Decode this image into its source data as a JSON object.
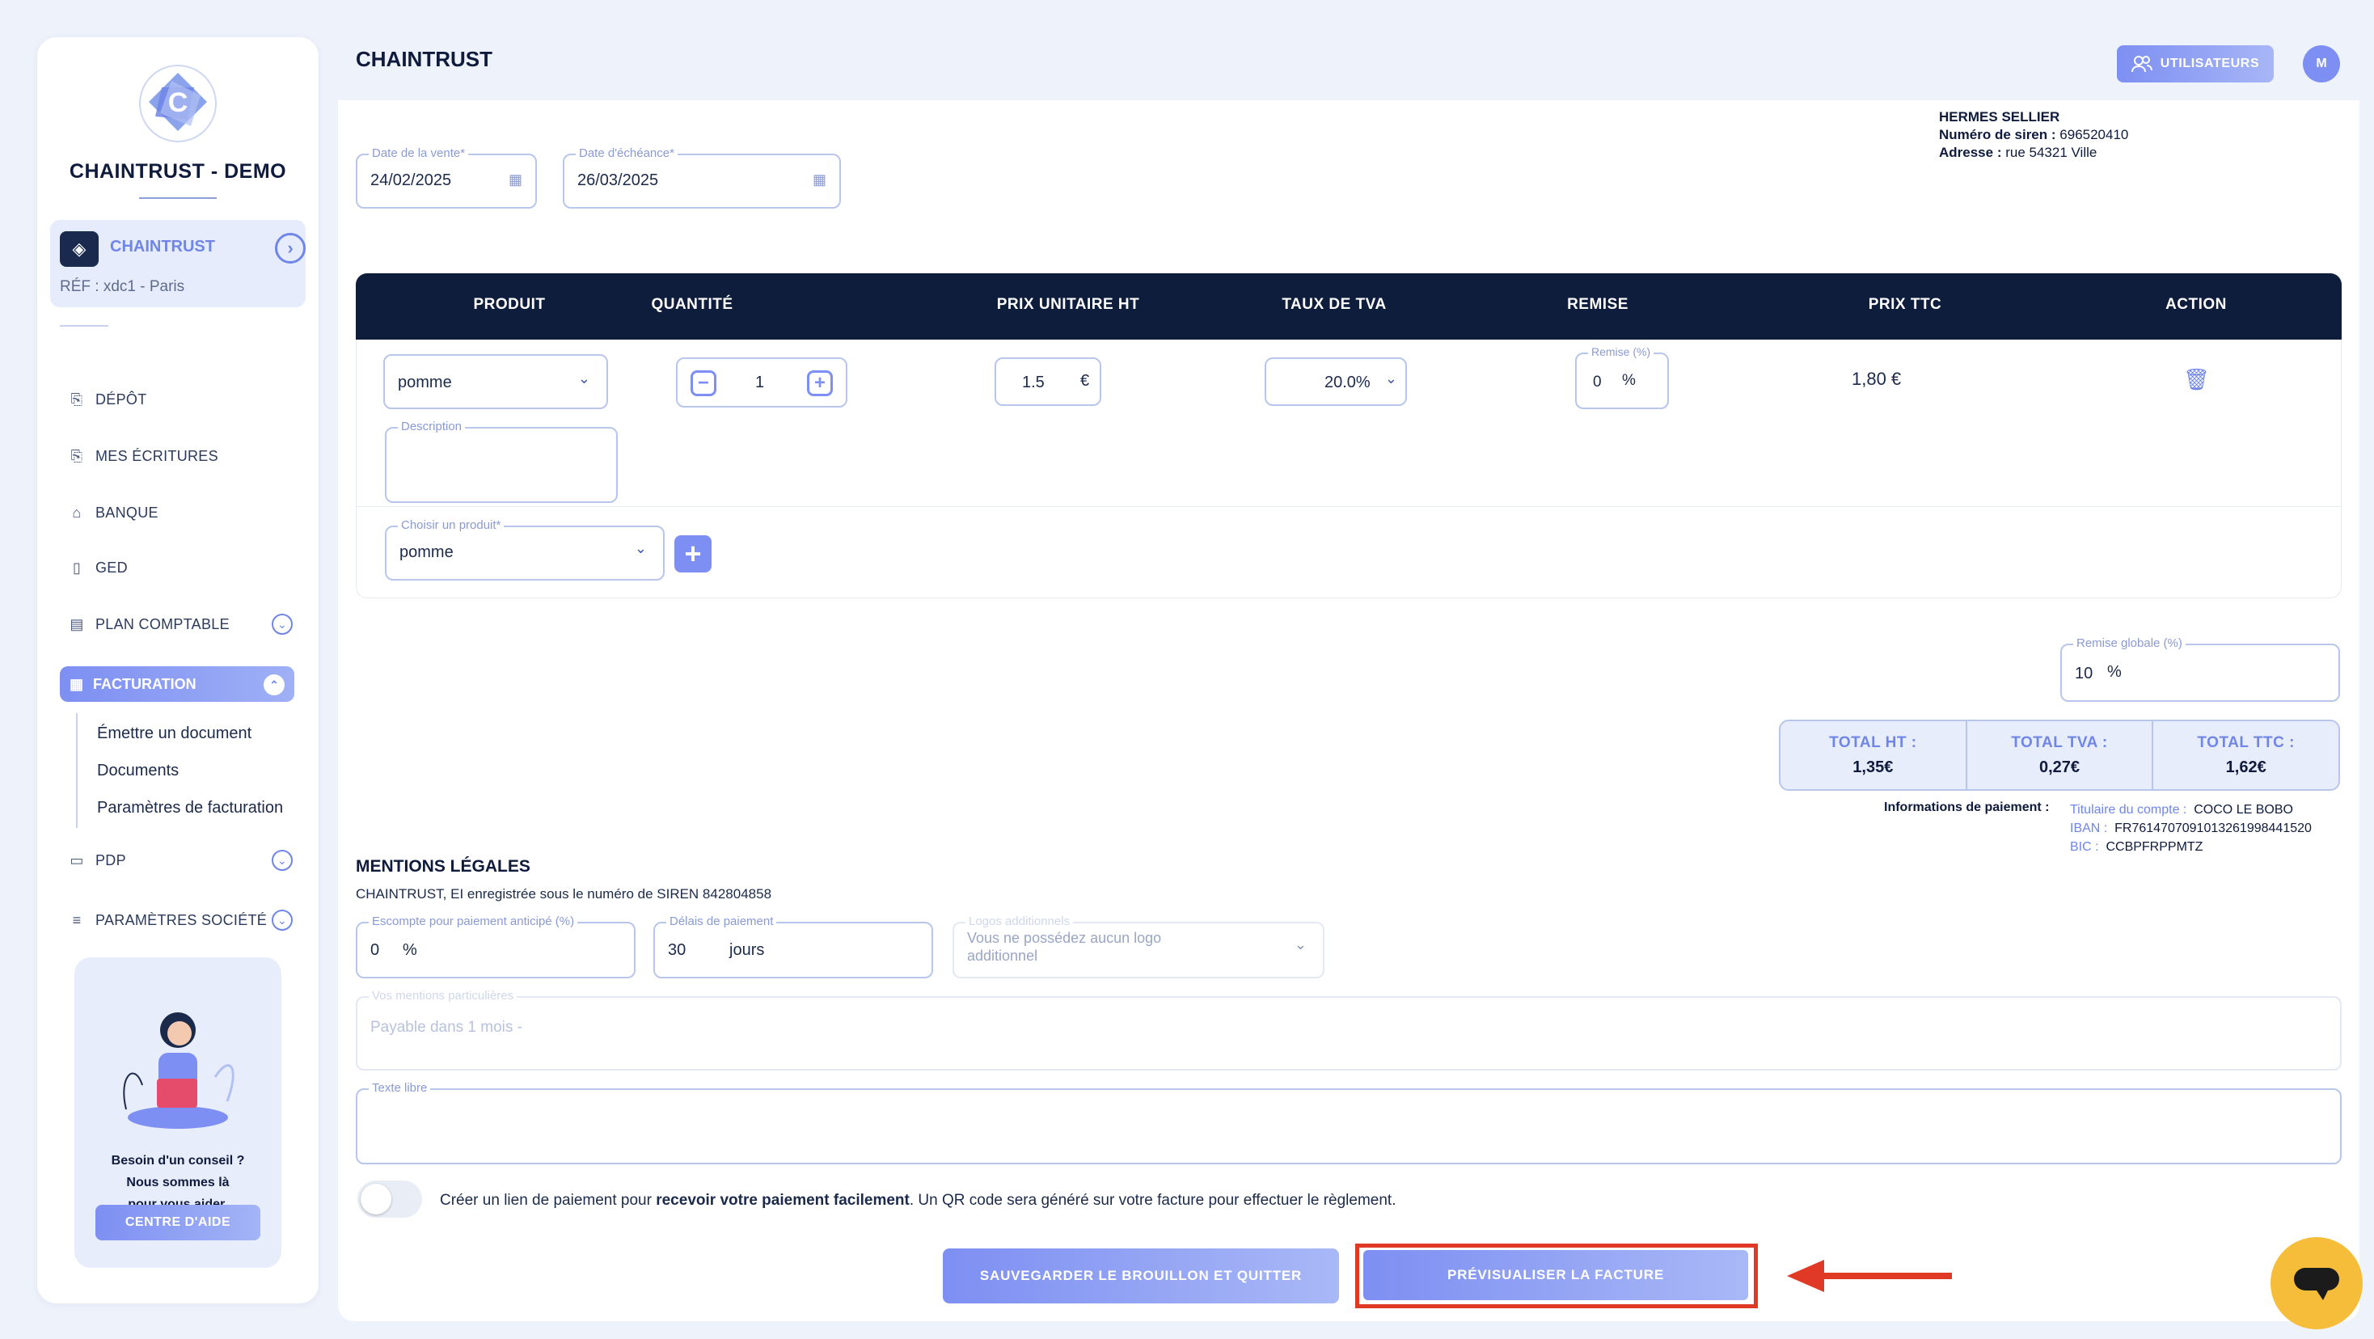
{
  "sidebar": {
    "brand": "CHAINTRUST - DEMO",
    "company_name": "CHAINTRUST",
    "company_ref": "RÉF : xdc1 - Paris",
    "items": [
      {
        "label": "DÉPÔT",
        "icon": "inbox-icon"
      },
      {
        "label": "MES ÉCRITURES",
        "icon": "inbox-icon"
      },
      {
        "label": "BANQUE",
        "icon": "bank-icon"
      },
      {
        "label": "GED",
        "icon": "document-icon"
      },
      {
        "label": "PLAN COMPTABLE",
        "icon": "book-icon"
      },
      {
        "label": "FACTURATION",
        "icon": "invoice-icon"
      },
      {
        "label": "PDP",
        "icon": "card-icon"
      },
      {
        "label": "PARAMÈTRES SOCIÉTÉ",
        "icon": "sliders-icon"
      }
    ],
    "sub_items": [
      "Émettre un document",
      "Documents",
      "Paramètres de facturation"
    ],
    "help_text_1": "Besoin d'un conseil ?",
    "help_text_2": "Nous sommes là",
    "help_text_3": "pour vous aider.",
    "help_button": "CENTRE D'AIDE"
  },
  "header": {
    "title": "CHAINTRUST",
    "users_button": "UTILISATEURS",
    "avatar_initial": "M"
  },
  "dates": {
    "sale_label": "Date de la vente*",
    "sale_value": "24/02/2025",
    "due_label": "Date d'échéance*",
    "due_value": "26/03/2025"
  },
  "seller": {
    "name": "HERMES SELLIER",
    "siren_label": "Numéro de siren :",
    "siren_value": "696520410",
    "address_label": "Adresse :",
    "address_value": "rue 54321 Ville"
  },
  "table": {
    "headers": [
      "PRODUIT",
      "QUANTITÉ",
      "PRIX UNITAIRE HT",
      "TAUX DE TVA",
      "REMISE",
      "PRIX TTC",
      "ACTION"
    ],
    "row": {
      "product": "pomme",
      "quantity": "1",
      "unit_price": "1.5",
      "currency": "€",
      "vat_rate": "20.0%",
      "discount_label": "Remise (%)",
      "discount_value": "0",
      "percent": "%",
      "price_ttc": "1,80 €",
      "description_label": "Description"
    },
    "choose_product_label": "Choisir un produit*",
    "choose_product_value": "pomme"
  },
  "global_discount": {
    "label": "Remise globale (%)",
    "value": "10",
    "unit": "%"
  },
  "totals": [
    {
      "label": "TOTAL HT :",
      "value": "1,35€"
    },
    {
      "label": "TOTAL TVA :",
      "value": "0,27€"
    },
    {
      "label": "TOTAL TTC :",
      "value": "1,62€"
    }
  ],
  "payment_info": {
    "title": "Informations de paiement :",
    "holder_label": "Titulaire du compte :",
    "holder_value": "COCO LE BOBO",
    "iban_label": "IBAN :",
    "iban_value": "FR7614707091013261998441520",
    "bic_label": "BIC :",
    "bic_value": "CCBPFRPPMTZ"
  },
  "legal": {
    "title": "MENTIONS LÉGALES",
    "subtitle": "CHAINTRUST, EI enregistrée sous le numéro de SIREN 842804858",
    "discount_label": "Escompte pour paiement anticipé (%)",
    "discount_value": "0",
    "discount_unit": "%",
    "delay_label": "Délais de paiement",
    "delay_value": "30",
    "delay_unit": "jours",
    "logos_label": "Logos additionnels",
    "logos_placeholder_1": "Vous ne possédez aucun logo",
    "logos_placeholder_2": "additionnel",
    "mentions_label": "Vos mentions particulières",
    "mentions_placeholder": "Payable dans 1 mois -",
    "free_text_label": "Texte libre"
  },
  "payment_link": {
    "text_before": "Créer un lien de paiement pour ",
    "text_bold": "recevoir votre paiement facilement",
    "text_after": ". Un QR code sera généré sur votre facture pour effectuer le règlement."
  },
  "actions": {
    "save_label": "SAUVEGARDER LE BROUILLON ET QUITTER",
    "preview_label": "PRÉVISUALISER LA FACTURE"
  },
  "colors": {
    "accent": "#7d8ff2",
    "navy": "#0f1d3d",
    "highlight": "#e03a26",
    "chat": "#f6bd3a"
  }
}
